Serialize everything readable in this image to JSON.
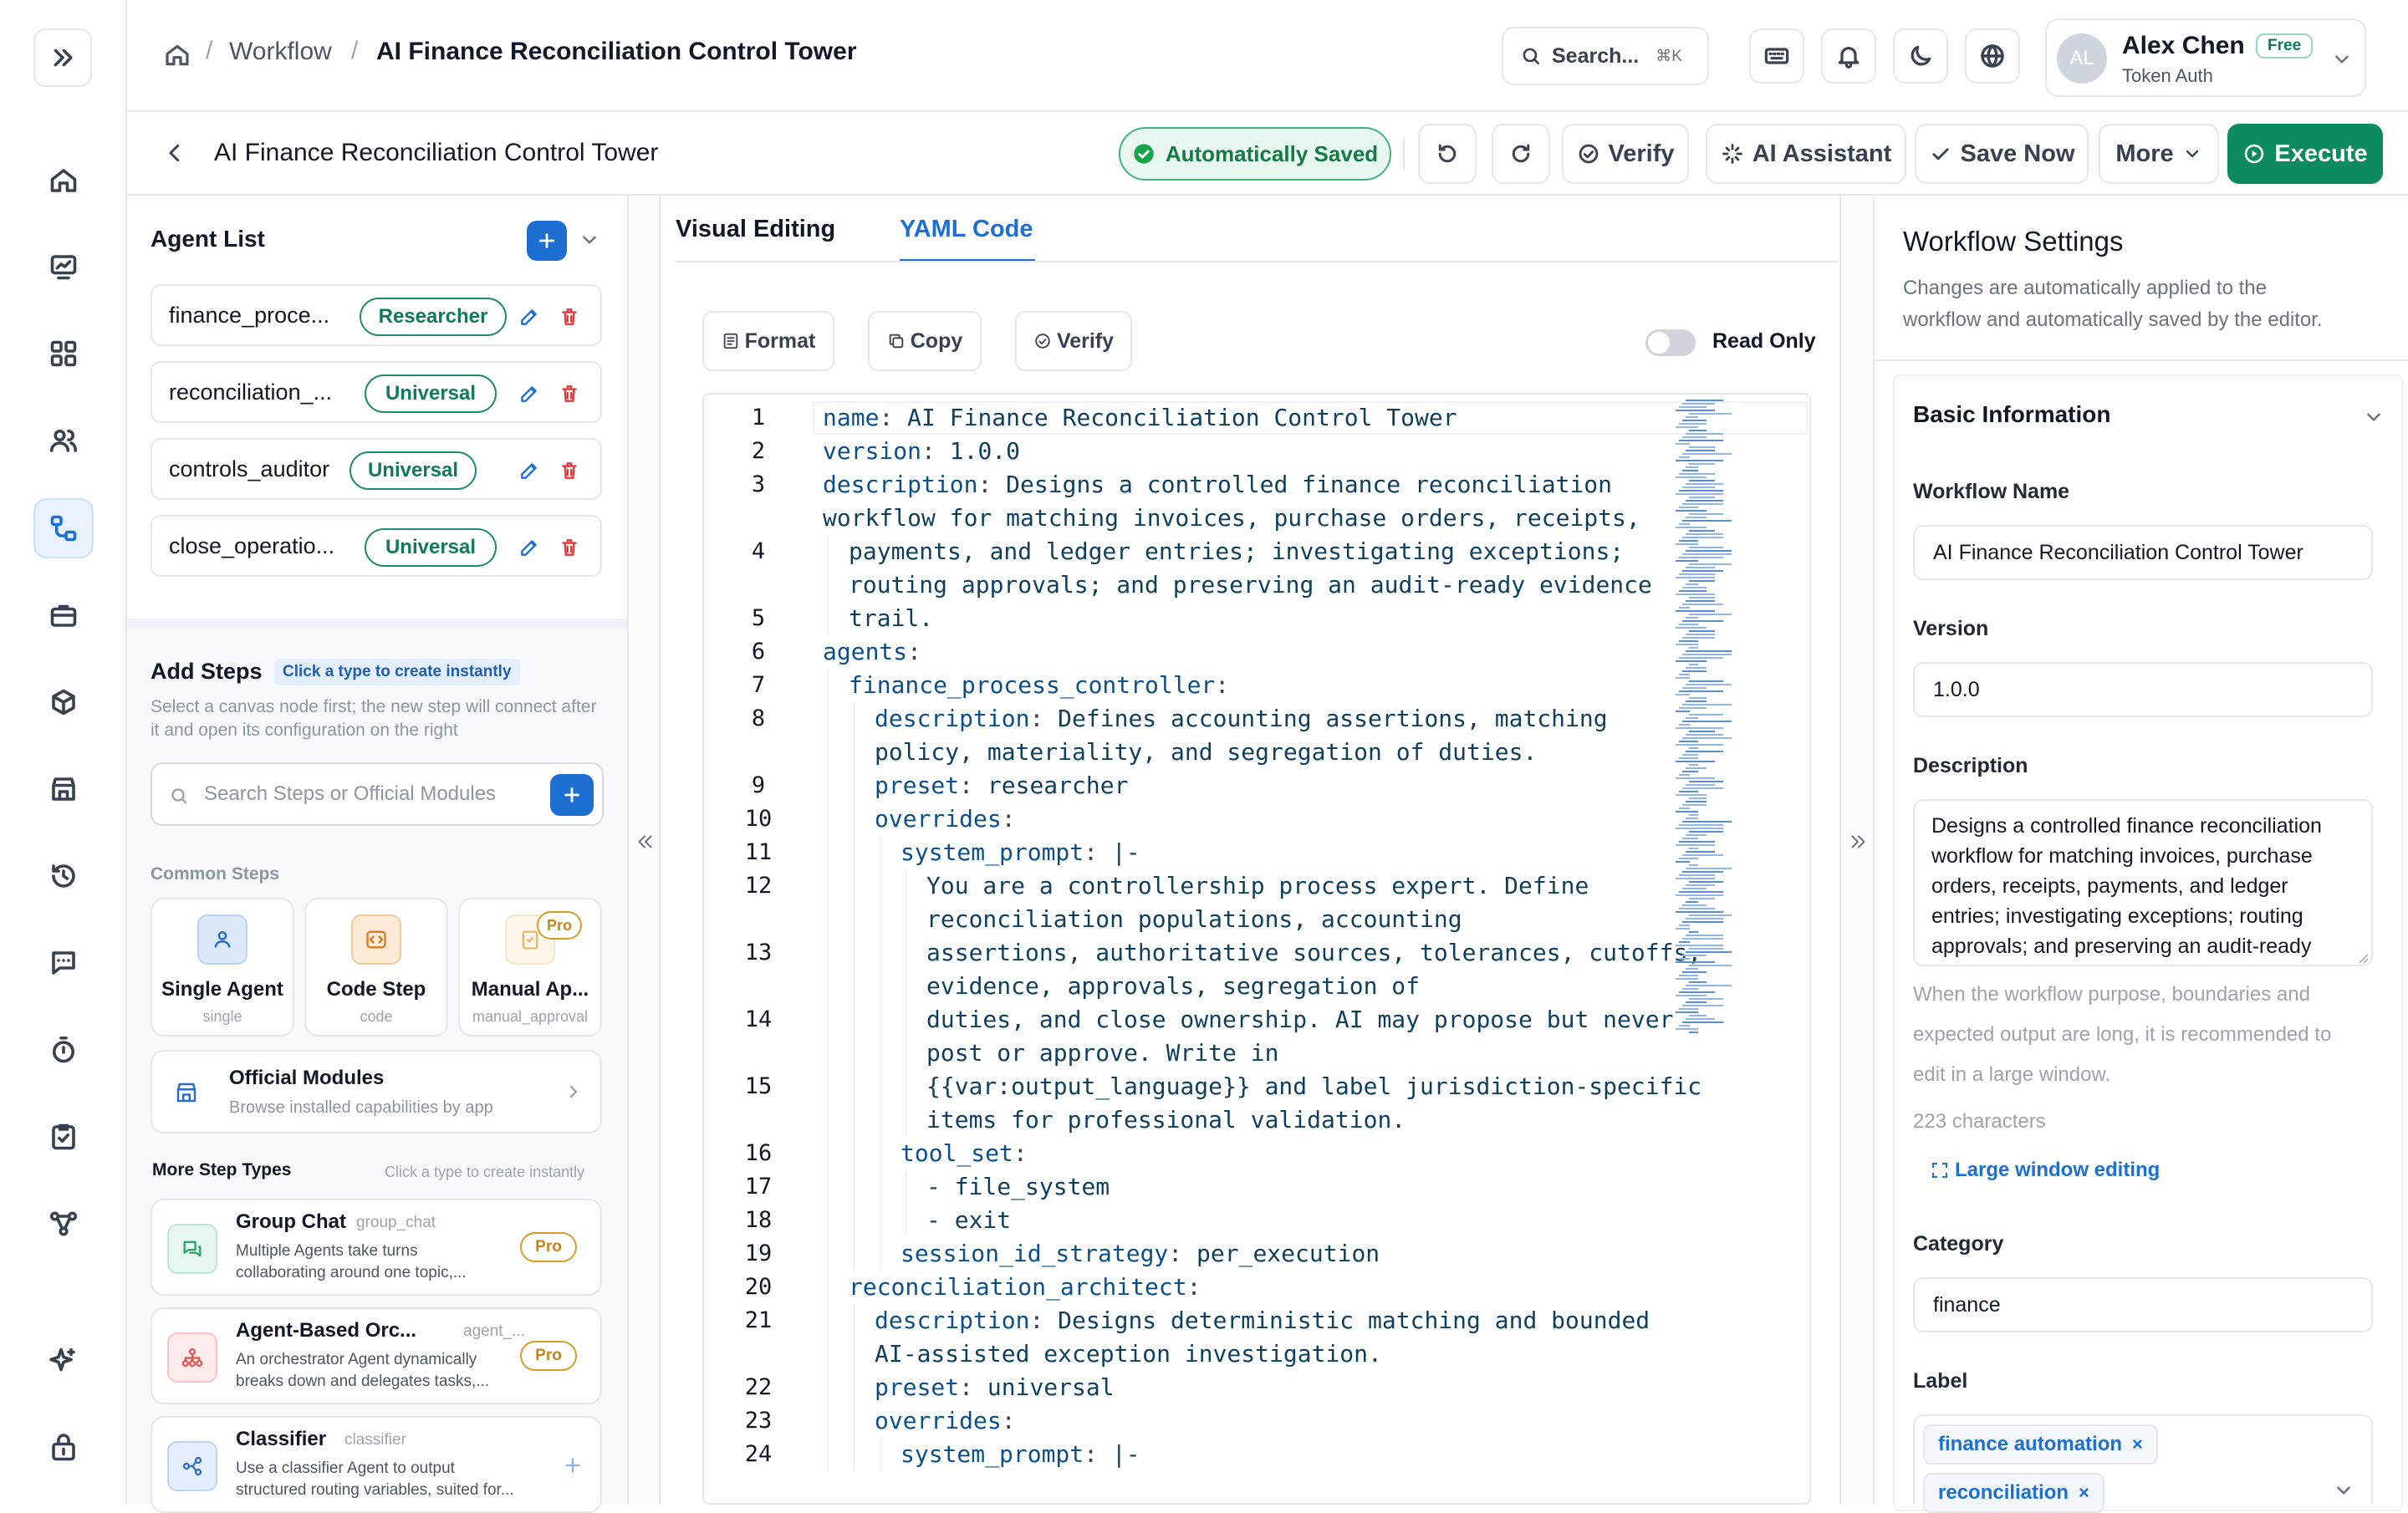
{
  "breadcrumb": {
    "workflow": "Workflow",
    "separator": "/",
    "current": "AI Finance Reconciliation Control Tower"
  },
  "search": {
    "label": "Search...",
    "shortcut": "⌘K"
  },
  "user": {
    "initials": "AL",
    "name": "Alex Chen",
    "plan": "Free",
    "auth": "Token Auth"
  },
  "toolbar": {
    "title": "AI Finance Reconciliation Control Tower",
    "saved_status": "Automatically Saved",
    "verify": "Verify",
    "ai_assistant": "AI Assistant",
    "save_now": "Save Now",
    "more": "More",
    "execute": "Execute"
  },
  "agents": {
    "title": "Agent List",
    "items": [
      {
        "name": "finance_proce...",
        "role": "Researcher"
      },
      {
        "name": "reconciliation_...",
        "role": "Universal"
      },
      {
        "name": "controls_auditor",
        "role": "Universal"
      },
      {
        "name": "close_operatio...",
        "role": "Universal"
      }
    ]
  },
  "add_steps": {
    "title": "Add Steps",
    "hint_badge": "Click a type to create instantly",
    "description": "Select a canvas node first; the new step will connect after it and open its configuration on the right",
    "search_placeholder": "Search Steps or Official Modules",
    "common_title": "Common Steps",
    "common": [
      {
        "name": "Single Agent",
        "code": "single"
      },
      {
        "name": "Code Step",
        "code": "code"
      },
      {
        "name": "Manual Ap...",
        "code": "manual_approval",
        "badge": "Pro"
      }
    ],
    "official": {
      "title": "Official Modules",
      "subtitle": "Browse installed capabilities by app"
    },
    "more_title": "More Step Types",
    "more_hint": "Click a type to create instantly",
    "more": [
      {
        "name": "Group Chat",
        "code": "group_chat",
        "desc1": "Multiple Agents take turns",
        "desc2": "collaborating around one topic,...",
        "badge": "Pro"
      },
      {
        "name": "Agent-Based Orc...",
        "code": "agent_...",
        "desc1": "An orchestrator Agent dynamically",
        "desc2": "breaks down and delegates tasks,...",
        "badge": "Pro"
      },
      {
        "name": "Classifier",
        "code": "classifier",
        "desc1": "Use a classifier Agent to output",
        "desc2": "structured routing variables, suited for..."
      }
    ]
  },
  "editor": {
    "tabs": [
      "Visual Editing",
      "YAML Code"
    ],
    "active_tab": "YAML Code",
    "actions": {
      "format": "Format",
      "copy": "Copy",
      "verify": "Verify"
    },
    "read_only": "Read Only",
    "lines": [
      {
        "n": "1",
        "k": "name",
        "v": " AI Finance Reconciliation Control Tower",
        "indent": 0
      },
      {
        "n": "2",
        "k": "version",
        "v": " 1.0.0",
        "indent": 0
      },
      {
        "n": "3",
        "k": "description",
        "v": " Designs a controlled finance reconciliation",
        "indent": 0
      },
      {
        "n": "",
        "k": "",
        "v": "workflow for matching invoices, purchase orders, receipts,",
        "indent": 0
      },
      {
        "n": "4",
        "k": "",
        "v": "payments, and ledger entries; investigating exceptions;",
        "indent": 1
      },
      {
        "n": "",
        "k": "",
        "v": "routing approvals; and preserving an audit-ready evidence",
        "indent": 1
      },
      {
        "n": "5",
        "k": "",
        "v": "trail.",
        "indent": 1
      },
      {
        "n": "6",
        "k": "agents",
        "v": "",
        "indent": 0
      },
      {
        "n": "7",
        "k": "finance_process_controller",
        "v": "",
        "indent": 1
      },
      {
        "n": "8",
        "k": "description",
        "v": " Defines accounting assertions, matching",
        "indent": 2
      },
      {
        "n": "",
        "k": "",
        "v": "policy, materiality, and segregation of duties.",
        "indent": 2
      },
      {
        "n": "9",
        "k": "preset",
        "v": " researcher",
        "indent": 2
      },
      {
        "n": "10",
        "k": "overrides",
        "v": "",
        "indent": 2
      },
      {
        "n": "11",
        "k": "system_prompt",
        "v": " |-",
        "indent": 3
      },
      {
        "n": "12",
        "k": "",
        "v": "You are a controllership process expert. Define",
        "indent": 4
      },
      {
        "n": "",
        "k": "",
        "v": "reconciliation populations, accounting",
        "indent": 4
      },
      {
        "n": "13",
        "k": "",
        "v": "assertions, authoritative sources, tolerances, cutoffs,",
        "indent": 4
      },
      {
        "n": "",
        "k": "",
        "v": "evidence, approvals, segregation of",
        "indent": 4
      },
      {
        "n": "14",
        "k": "",
        "v": "duties, and close ownership. AI may propose but never",
        "indent": 4
      },
      {
        "n": "",
        "k": "",
        "v": "post or approve. Write in",
        "indent": 4
      },
      {
        "n": "15",
        "k": "",
        "v": "{{var:output_language}} and label jurisdiction-specific",
        "indent": 4
      },
      {
        "n": "",
        "k": "",
        "v": "items for professional validation.",
        "indent": 4
      },
      {
        "n": "16",
        "k": "tool_set",
        "v": "",
        "indent": 3
      },
      {
        "n": "17",
        "k": "",
        "v": "- file_system",
        "indent": 4
      },
      {
        "n": "18",
        "k": "",
        "v": "- exit",
        "indent": 4
      },
      {
        "n": "19",
        "k": "session_id_strategy",
        "v": " per_execution",
        "indent": 3
      },
      {
        "n": "20",
        "k": "reconciliation_architect",
        "v": "",
        "indent": 1
      },
      {
        "n": "21",
        "k": "description",
        "v": " Designs deterministic matching and bounded",
        "indent": 2
      },
      {
        "n": "",
        "k": "",
        "v": "AI-assisted exception investigation.",
        "indent": 2
      },
      {
        "n": "22",
        "k": "preset",
        "v": " universal",
        "indent": 2
      },
      {
        "n": "23",
        "k": "overrides",
        "v": "",
        "indent": 2
      },
      {
        "n": "24",
        "k": "system_prompt",
        "v": " |-",
        "indent": 3
      }
    ]
  },
  "settings": {
    "title": "Workflow Settings",
    "subtitle_1": "Changes are automatically applied to the",
    "subtitle_2": "workflow and automatically saved by the editor.",
    "section": "Basic Information",
    "name_label": "Workflow Name",
    "name_value": "AI Finance Reconciliation Control Tower",
    "version_label": "Version",
    "version_value": "1.0.0",
    "description_label": "Description",
    "description_value": "Designs a controlled finance reconciliation workflow for matching invoices, purchase orders, receipts, payments, and ledger entries; investigating exceptions; routing approvals; and preserving an audit-ready evidence trail.",
    "hint_1": "When the workflow purpose, boundaries and",
    "hint_2": "expected output are long, it is recommended to",
    "hint_3": "edit in a large window.",
    "char_count": "223 characters",
    "large_window": "Large window editing",
    "category_label": "Category",
    "category_value": "finance",
    "label_label": "Label",
    "labels": [
      "finance automation",
      "reconciliation"
    ]
  },
  "colors": {
    "accent": "#1d6fd1",
    "execute": "#0e8a5f",
    "saved_bg": "#e8f7ef",
    "pro": "#d99a2b"
  }
}
